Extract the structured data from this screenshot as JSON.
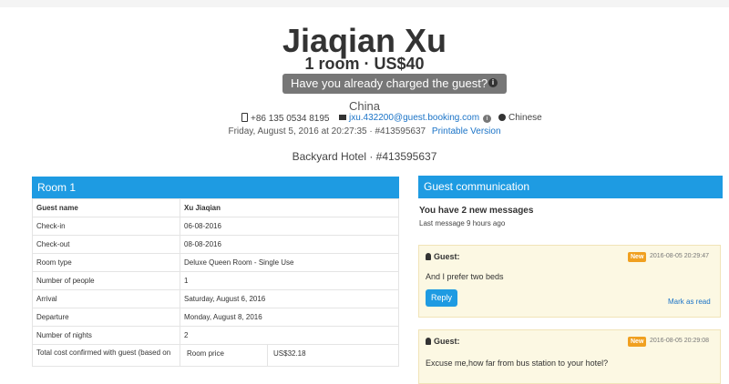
{
  "header": {
    "guest_name": "Jiaqian Xu",
    "summary": "1 room · US$40",
    "charged_button": "Have you already charged the guest?",
    "country": "China",
    "phone": "+86 135 0534 8195",
    "email": "jxu.432200@guest.booking.com",
    "language": "Chinese",
    "date_line": "Friday, August 5, 2016 at 20:27:35 · #413595637",
    "printable_link": "Printable Version",
    "hotel_line": "Backyard Hotel · #413595637"
  },
  "room": {
    "title": "Room 1",
    "rows": [
      {
        "key": "Guest name",
        "value": "Xu Jiaqian"
      },
      {
        "key": "Check-in",
        "value": "06-08-2016"
      },
      {
        "key": "Check-out",
        "value": "08-08-2016"
      },
      {
        "key": "Room type",
        "value": "Deluxe Queen Room - Single Use"
      },
      {
        "key": "Number of people",
        "value": "1"
      },
      {
        "key": "Arrival",
        "value": "Saturday, August 6, 2016"
      },
      {
        "key": "Departure",
        "value": "Monday, August 8, 2016"
      },
      {
        "key": "Number of nights",
        "value": "2"
      }
    ],
    "total_label": "Total cost confirmed with guest (based on",
    "room_price_label": "Room price",
    "room_price_value": "US$32.18"
  },
  "communication": {
    "title": "Guest communication",
    "new_messages": "You have 2 new messages",
    "last_message": "Last message 9 hours ago",
    "messages": [
      {
        "from": "Guest:",
        "badge": "New",
        "time": "2016-08-05 20:29:47",
        "text": "And I prefer two beds",
        "reply": "Reply",
        "mark_read": "Mark as read"
      },
      {
        "from": "Guest:",
        "badge": "New",
        "time": "2016-08-05 20:29:08",
        "text": "Excuse me,how far from bus station to your hotel?"
      }
    ]
  }
}
